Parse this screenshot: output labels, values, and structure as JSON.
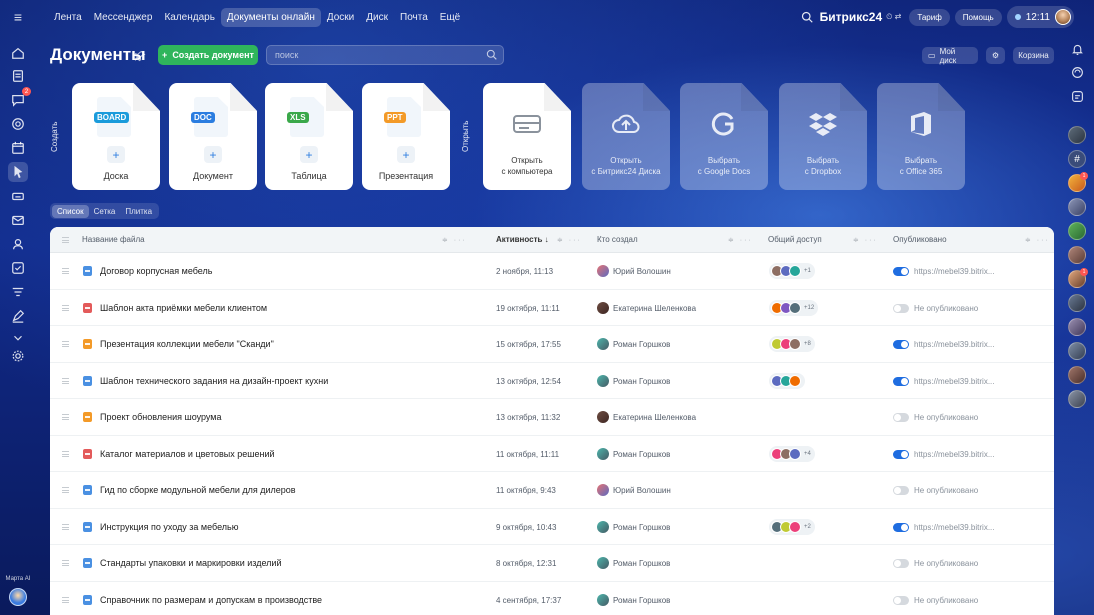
{
  "nav": {
    "items": [
      "Лента",
      "Мессенджер",
      "Календарь",
      "Документы онлайн",
      "Доски",
      "Диск",
      "Почта",
      "Ещё"
    ],
    "active_index": 3
  },
  "topright": {
    "brand": "Битрикс24",
    "tariff": "Тариф",
    "help": "Помощь",
    "time": "12:11"
  },
  "leftbar": {
    "messages_badge": "2",
    "assistant_label": "Марта AI"
  },
  "header": {
    "title": "Документы",
    "create_label": "Создать документ",
    "search_placeholder": "поиск",
    "my_disk": "Мой диск",
    "trash": "Корзина"
  },
  "create": {
    "label": "Создать",
    "cards": [
      {
        "tag": "BOARD",
        "tag_color": "#1a9bdb",
        "label": "Доска"
      },
      {
        "tag": "DOC",
        "tag_color": "#2b7de0",
        "label": "Документ"
      },
      {
        "tag": "XLS",
        "tag_color": "#3aa84a",
        "label": "Таблица"
      },
      {
        "tag": "PPT",
        "tag_color": "#f39a28",
        "label": "Презентация"
      }
    ]
  },
  "open": {
    "label": "Открыть",
    "cards": [
      {
        "icon": "hard-drive-icon",
        "line1": "Открыть",
        "line2": "с компьютера",
        "ghost": false
      },
      {
        "icon": "cloud-upload-icon",
        "line1": "Открыть",
        "line2": "с Битрикс24 Диска",
        "ghost": true
      },
      {
        "icon": "google-icon",
        "line1": "Выбрать",
        "line2": "с Google Docs",
        "ghost": true
      },
      {
        "icon": "dropbox-icon",
        "line1": "Выбрать",
        "line2": "с Dropbox",
        "ghost": true
      },
      {
        "icon": "office-icon",
        "line1": "Выбрать",
        "line2": "с Office 365",
        "ghost": true
      }
    ]
  },
  "views": {
    "items": [
      "Список",
      "Сетка",
      "Плитка"
    ],
    "active_index": 0
  },
  "table": {
    "columns": {
      "name": "Название файла",
      "activity": "Активность ↓",
      "author": "Кто создал",
      "shared": "Общий доступ",
      "published": "Опубликовано"
    },
    "rows": [
      {
        "type": "doc",
        "name": "Договор корпусная мебель",
        "activity": "2 ноября, 11:13",
        "author": "Юрий Волошин",
        "shared": 3,
        "more": "+1",
        "published": true,
        "pub_text": "https://mebel39.bitrix..."
      },
      {
        "type": "pdf",
        "name": "Шаблон акта приёмки мебели клиентом",
        "activity": "19 октября, 11:11",
        "author": "Екатерина Шеленкова",
        "shared": 3,
        "more": "+12",
        "published": false,
        "pub_text": "Не опубликовано"
      },
      {
        "type": "ppt",
        "name": "Презентация коллекции мебели \"Сканди\"",
        "activity": "15 октября, 17:55",
        "author": "Роман Горшков",
        "shared": 3,
        "more": "+8",
        "published": true,
        "pub_text": "https://mebel39.bitrix..."
      },
      {
        "type": "doc",
        "name": "Шаблон технического задания на дизайн-проект кухни",
        "activity": "13 октября, 12:54",
        "author": "Роман Горшков",
        "shared": 3,
        "more": "",
        "published": true,
        "pub_text": "https://mebel39.bitrix..."
      },
      {
        "type": "ppt",
        "name": "Проект обновления шоурума",
        "activity": "13 октября, 11:32",
        "author": "Екатерина Шеленкова",
        "shared": 0,
        "more": "",
        "published": false,
        "pub_text": "Не опубликовано"
      },
      {
        "type": "pdf",
        "name": "Каталог материалов и цветовых решений",
        "activity": "11 октября, 11:11",
        "author": "Роман Горшков",
        "shared": 3,
        "more": "+4",
        "published": true,
        "pub_text": "https://mebel39.bitrix..."
      },
      {
        "type": "doc",
        "name": "Гид по сборке модульной мебели для дилеров",
        "activity": "11 октября, 9:43",
        "author": "Юрий Волошин",
        "shared": 0,
        "more": "",
        "published": false,
        "pub_text": "Не опубликовано"
      },
      {
        "type": "doc",
        "name": "Инструкция по уходу за мебелью",
        "activity": "9 октября, 10:43",
        "author": "Роман Горшков",
        "shared": 3,
        "more": "+2",
        "published": true,
        "pub_text": "https://mebel39.bitrix..."
      },
      {
        "type": "doc",
        "name": "Стандарты упаковки и маркировки изделий",
        "activity": "8 октября, 12:31",
        "author": "Роман Горшков",
        "shared": 0,
        "more": "",
        "published": false,
        "pub_text": "Не опубликовано"
      },
      {
        "type": "doc",
        "name": "Справочник по размерам и допускам в производстве",
        "activity": "4 сентября, 17:37",
        "author": "Роман Горшков",
        "shared": 0,
        "more": "",
        "published": false,
        "pub_text": "Не опубликовано"
      }
    ]
  },
  "colors": {
    "accent": "#2fb55c",
    "toggle_on": "#1f6de0",
    "doc": "#4a90e2",
    "pdf": "#e35a5a",
    "ppt": "#f39a28"
  }
}
